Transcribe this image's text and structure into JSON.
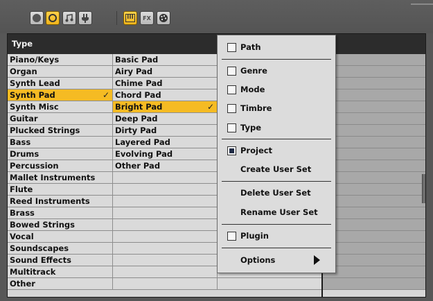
{
  "toolbar": {
    "buttons": [
      {
        "icon": "instrument-circle-icon",
        "active": false
      },
      {
        "icon": "ring-circle-icon",
        "active": true
      },
      {
        "icon": "music-note-icon",
        "active": false
      },
      {
        "icon": "plug-icon",
        "active": false
      },
      {
        "icon": "keyboard-icon",
        "active": true
      },
      {
        "icon": "fx-icon",
        "label": "FX",
        "active": false
      },
      {
        "icon": "palette-icon",
        "active": false
      }
    ]
  },
  "table": {
    "header": "Type",
    "col1": [
      "Piano/Keys",
      "Organ",
      "Synth Lead",
      "Synth Pad",
      "Synth Misc",
      "Guitar",
      "Plucked Strings",
      "Bass",
      "Drums",
      "Percussion",
      "Mallet Instruments",
      "Flute",
      "Reed Instruments",
      "Brass",
      "Bowed Strings",
      "Vocal",
      "Soundscapes",
      "Sound Effects",
      "Multitrack",
      "Other"
    ],
    "col1_selected": "Synth Pad",
    "col2": [
      "Basic Pad",
      "Airy Pad",
      "Chime Pad",
      "Chord Pad",
      "Bright Pad",
      "Deep Pad",
      "Dirty Pad",
      "Layered Pad",
      "Evolving Pad",
      "Other Pad"
    ],
    "col2_selected": "Bright Pad",
    "check_mark": "✓"
  },
  "menu": {
    "path": "Path",
    "genre": "Genre",
    "mode": "Mode",
    "timbre": "Timbre",
    "type": "Type",
    "project": "Project",
    "create_user_set": "Create User Set",
    "delete_user_set": "Delete User Set",
    "rename_user_set": "Rename User Set",
    "plugin": "Plugin",
    "options": "Options"
  },
  "colors": {
    "selection": "#f5bb23",
    "header_bg": "#2c2c2c",
    "toolbar_active": "#ffd24a"
  }
}
